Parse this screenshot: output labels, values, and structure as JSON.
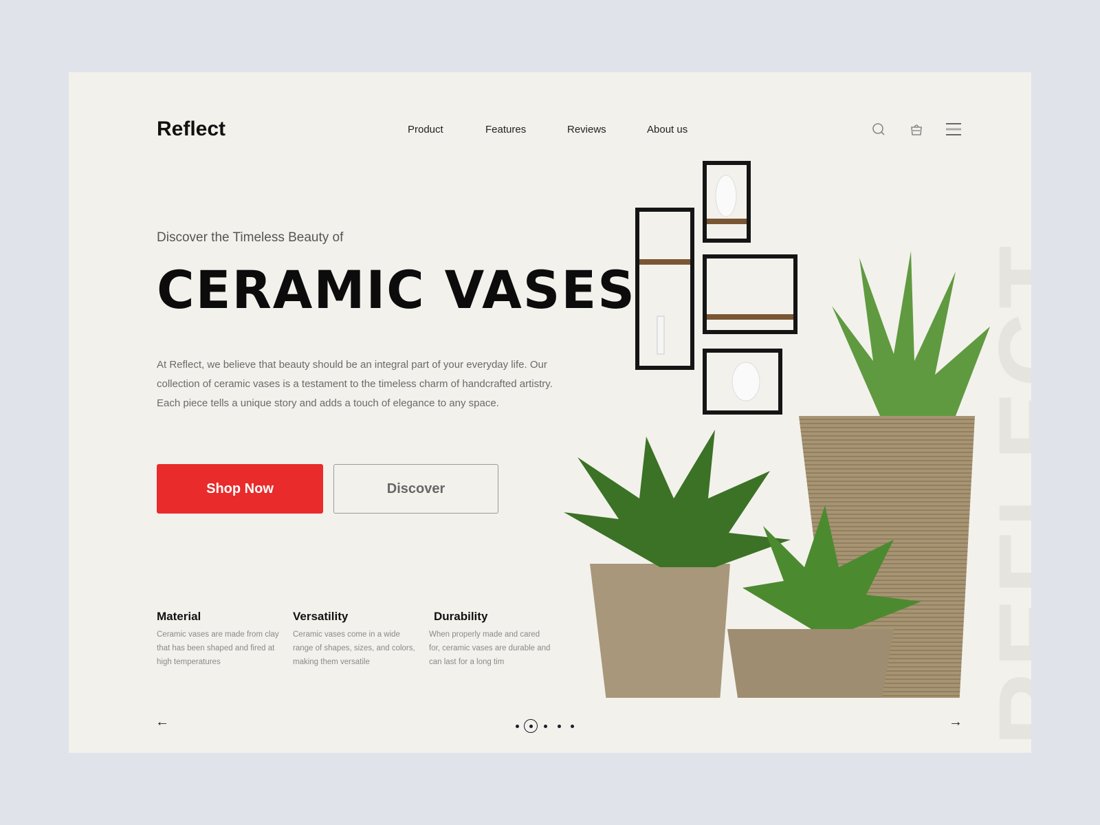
{
  "brand": "Reflect",
  "nav": [
    "Product",
    "Features",
    "Reviews",
    "About us"
  ],
  "header_icons": [
    "search-icon",
    "shopping-bag-icon",
    "menu-icon"
  ],
  "hero": {
    "subtitle": "Discover the Timeless Beauty of",
    "title": "CERAMIC VASES",
    "description": "At Reflect, we believe that beauty should be an integral part of your everyday life. Our collection of ceramic vases is a testament to the timeless charm of handcrafted artistry. Each piece tells a unique story and adds a touch of elegance to any space.",
    "primary_button": "Shop Now",
    "secondary_button": "Discover"
  },
  "features": [
    {
      "title": "Material",
      "text": "Ceramic vases are made from clay that has been shaped and fired at high temperatures"
    },
    {
      "title": "Versatility",
      "text": "Ceramic vases come in a wide range of shapes, sizes, and colors, making them versatile"
    },
    {
      "title": "Durability",
      "text": "When properly made and cared for, ceramic vases are durable and can last for a long tim"
    }
  ],
  "watermark": "REFLECT",
  "carousel": {
    "total_slides": 5,
    "active_slide": 2
  },
  "colors": {
    "accent": "#e92b2b",
    "background": "#f3f1ec",
    "page": "#e0e3ea"
  }
}
